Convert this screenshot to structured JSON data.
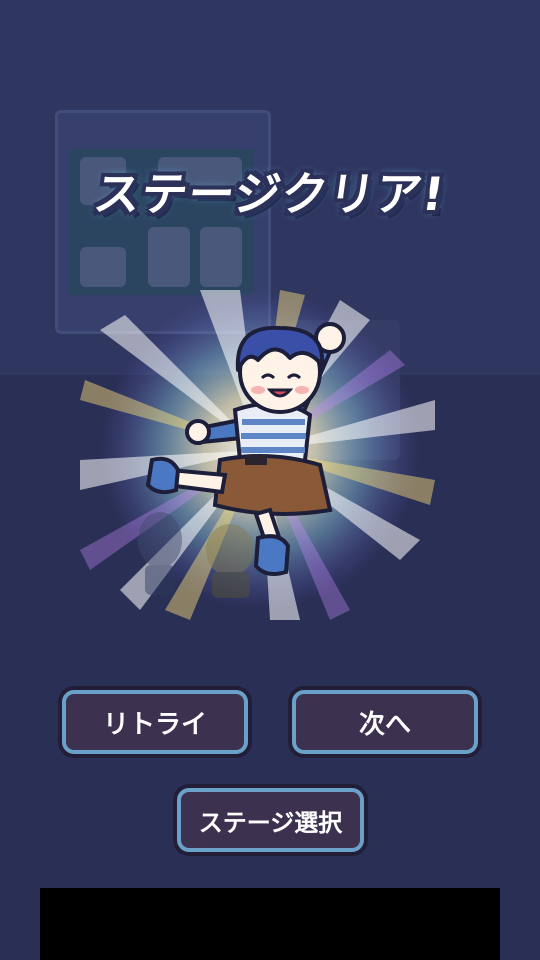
{
  "title": "ステージクリア!",
  "buttons": {
    "retry": "リトライ",
    "next": "次へ",
    "stage_select": "ステージ選択"
  },
  "colors": {
    "background": "#2b3158",
    "button_fill": "#3d3150",
    "button_border": "#6aa1c8",
    "title_glow": "#6fd0ff"
  }
}
